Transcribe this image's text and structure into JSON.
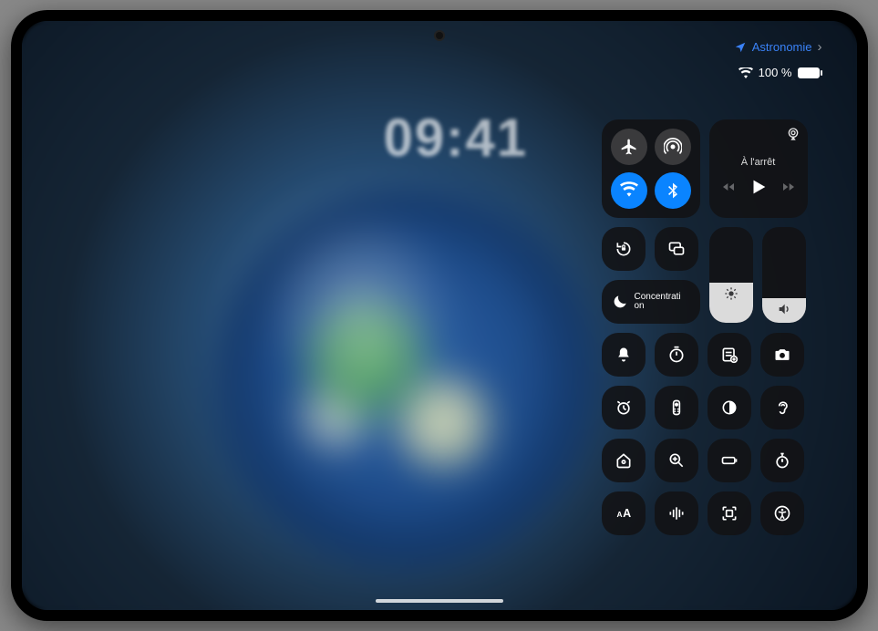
{
  "status": {
    "active_app": "Astronomie",
    "battery_text": "100 %",
    "battery_level": 100
  },
  "lockscreen": {
    "time": "09:41"
  },
  "controlCenter": {
    "connectivity": {
      "airplane": {
        "active": false
      },
      "airdrop": {
        "active": false
      },
      "wifi": {
        "active": true
      },
      "bluetooth": {
        "active": true
      }
    },
    "media": {
      "status_label": "À l'arrêt"
    },
    "focus": {
      "label": "Concentration"
    },
    "brightness_pct": 42,
    "volume_pct": 26
  }
}
